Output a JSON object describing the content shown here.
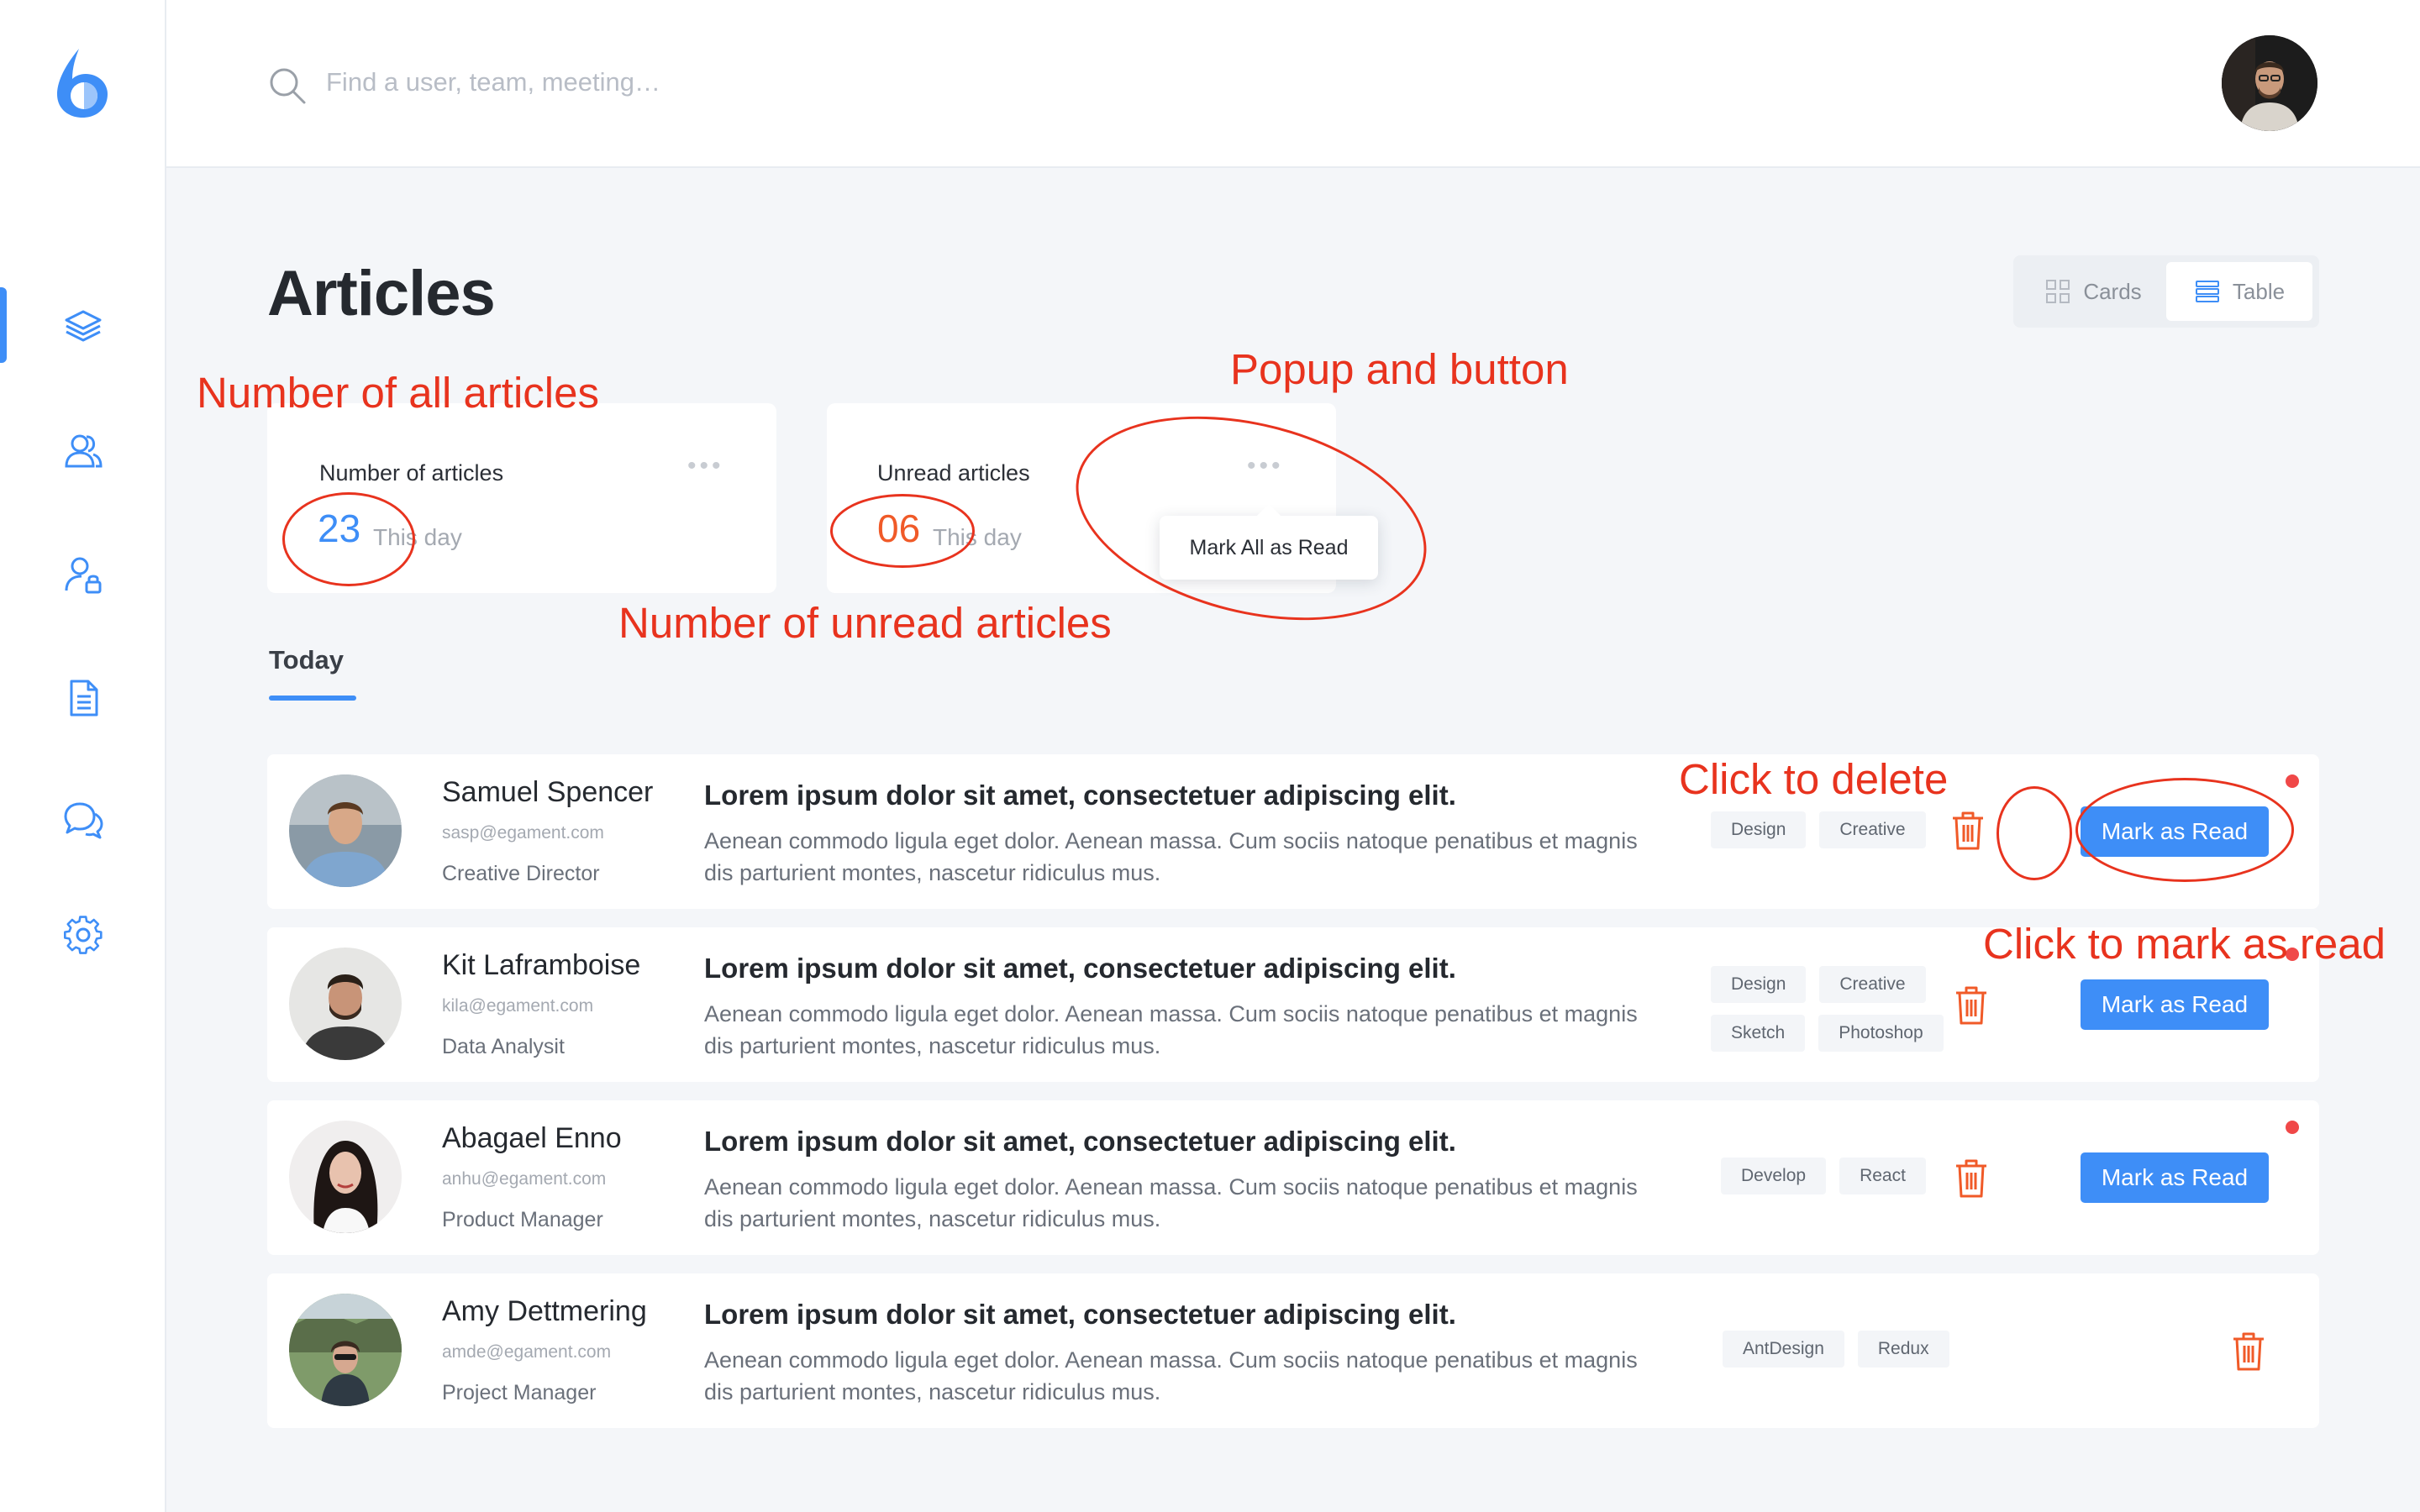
{
  "search": {
    "placeholder": "Find a user, team, meeting…",
    "value": ""
  },
  "page": {
    "title": "Articles"
  },
  "view_toggle": {
    "cards_label": "Cards",
    "table_label": "Table",
    "selected": "Table"
  },
  "stats": {
    "all": {
      "label": "Number of articles",
      "value": "23",
      "sub": "This day",
      "value_color": "#3e8ef7"
    },
    "unread": {
      "label": "Unread articles",
      "value": "06",
      "sub": "This day",
      "value_color": "#f05a28"
    }
  },
  "popup": {
    "label": "Mark All as Read"
  },
  "tabs": {
    "today": "Today"
  },
  "articles": [
    {
      "name": "Samuel Spencer",
      "email": "sasp@egament.com",
      "role": "Creative Director",
      "title": "Lorem ipsum dolor sit amet, consectetuer adipiscing elit.",
      "desc": "Aenean commodo ligula eget dolor. Aenean massa. Cum sociis natoque penatibus et magnis dis parturient montes, nascetur ridiculus mus.",
      "tags": [
        "Design",
        "Creative"
      ],
      "unread": true,
      "button": "Mark as Read"
    },
    {
      "name": "Kit Laframboise",
      "email": "kila@egament.com",
      "role": "Data Analysit",
      "title": "Lorem ipsum dolor sit amet, consectetuer adipiscing elit.",
      "desc": "Aenean commodo ligula eget dolor. Aenean massa. Cum sociis natoque penatibus et magnis dis parturient montes, nascetur ridiculus mus.",
      "tags": [
        "Design",
        "Creative",
        "Sketch",
        "Photoshop"
      ],
      "unread": true,
      "button": "Mark as Read"
    },
    {
      "name": "Abagael Enno",
      "email": "anhu@egament.com",
      "role": "Product Manager",
      "title": "Lorem ipsum dolor sit amet, consectetuer adipiscing elit.",
      "desc": "Aenean commodo ligula eget dolor. Aenean massa. Cum sociis natoque penatibus et magnis dis parturient montes, nascetur ridiculus mus.",
      "tags": [
        "Develop",
        "React"
      ],
      "unread": true,
      "button": "Mark as Read"
    },
    {
      "name": "Amy Dettmering",
      "email": "amde@egament.com",
      "role": "Project Manager",
      "title": "Lorem ipsum dolor sit amet, consectetuer adipiscing elit.",
      "desc": "Aenean commodo ligula eget dolor. Aenean massa. Cum sociis natoque penatibus et magnis dis parturient montes, nascetur ridiculus mus.",
      "tags": [
        "AntDesign",
        "Redux"
      ],
      "unread": false,
      "button": ""
    }
  ],
  "annotations": {
    "all_articles": "Number of all articles",
    "popup_button": "Popup and button",
    "unread_articles": "Number of unread articles",
    "delete": "Click to delete",
    "mark_read": "Click to mark as read"
  },
  "colors": {
    "accent": "#3e8ef7",
    "danger": "#f05a28",
    "annotation": "#e8331e",
    "unread_dot": "#f04848"
  },
  "icons": {
    "sidebar": [
      "layers-icon",
      "users-icon",
      "user-lock-icon",
      "document-icon",
      "chat-icon",
      "gear-icon"
    ],
    "logo": "drop-logo-icon",
    "search": "search-icon",
    "delete": "trash-icon"
  }
}
